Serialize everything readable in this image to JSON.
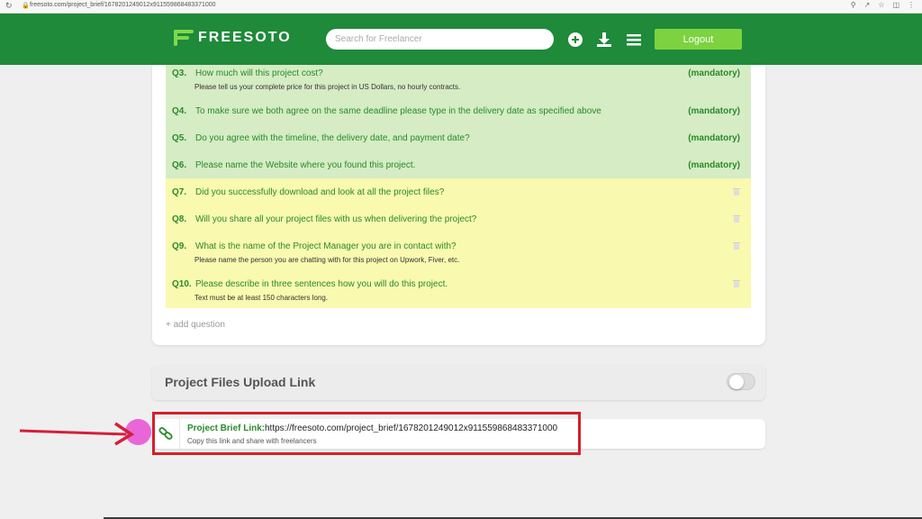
{
  "browser": {
    "url": "freesoto.com/project_brief/1678201249012x911559868483371000"
  },
  "header": {
    "logo_text": "FREESOTO",
    "search_placeholder": "Search for Freelancer",
    "logout_label": "Logout",
    "icons": [
      "plus-circle-icon",
      "download-icon",
      "menu-icon"
    ],
    "brand_color": "#1e8a3a",
    "accent_color": "#7dd23f"
  },
  "questions": [
    {
      "num": "Q3.",
      "text": "How much will this project cost?",
      "sub": "Please tell us your complete price for this project in US Dollars, no hourly contracts.",
      "tag": "(mandatory)"
    },
    {
      "num": "Q4.",
      "text": "To make sure we both agree on the same deadline please type in the delivery date as specified above",
      "tag": "(mandatory)"
    },
    {
      "num": "Q5.",
      "text": "Do you agree with the timeline, the delivery date, and payment date?",
      "tag": "(mandatory)"
    },
    {
      "num": "Q6.",
      "text": "Please name the Website where you found this project.",
      "tag": "(mandatory)"
    },
    {
      "num": "Q7.",
      "text": "Did you successfully download and look at all the project files?"
    },
    {
      "num": "Q8.",
      "text": "Will you share all your project files with us when delivering the project?"
    },
    {
      "num": "Q9.",
      "text": "What is the name of the Project Manager you are in contact with?",
      "sub": "Please name the person you are chatting with for this project on Upwork, Fiver, etc."
    },
    {
      "num": "Q10.",
      "text": "Please describe in three sentences how you will do this project.",
      "sub": "Text must be at least 150 characters long."
    }
  ],
  "add_question_label": "+ add question",
  "upload": {
    "title": "Project Files Upload Link",
    "toggle_on": false
  },
  "brief": {
    "label": "Project Brief Link:",
    "url": "https://freesoto.com/project_brief/1678201249012x911559868483371000",
    "sub": "Copy this link and share with freelancers"
  }
}
